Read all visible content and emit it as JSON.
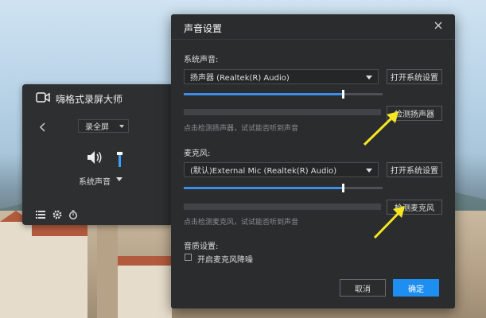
{
  "recorder": {
    "title": "嗨格式录屏大师",
    "mode": "录全屏",
    "source": "系统声音",
    "system_volume": 0.7
  },
  "dialog": {
    "title": "声音设置",
    "system_sound": {
      "label": "系统声音:",
      "device": "扬声器 (Realtek(R) Audio)",
      "open_settings": "打开系统设置",
      "volume": 0.8,
      "detect_button": "检测扬声器",
      "hint": "点击检测扬声器，试试能否听到声音"
    },
    "microphone": {
      "label": "麦克风:",
      "device": "(默认)External Mic (Realtek(R) Audio)",
      "open_settings": "打开系统设置",
      "volume": 0.8,
      "detect_button": "检测麦克风",
      "hint": "点击检测麦克风，试试能否听到声音"
    },
    "quality": {
      "label": "音质设置:",
      "noise_reduction_label": "开启麦克风降噪",
      "noise_reduction_checked": false
    },
    "cancel_label": "取消",
    "ok_label": "确定"
  },
  "colors": {
    "accent": "#1f8ef1",
    "dialog_bg": "#2b2c2e",
    "annotation": "#f5e623"
  },
  "icons": {
    "close": "close-icon",
    "camera": "camera-icon",
    "speaker": "speaker-icon"
  }
}
